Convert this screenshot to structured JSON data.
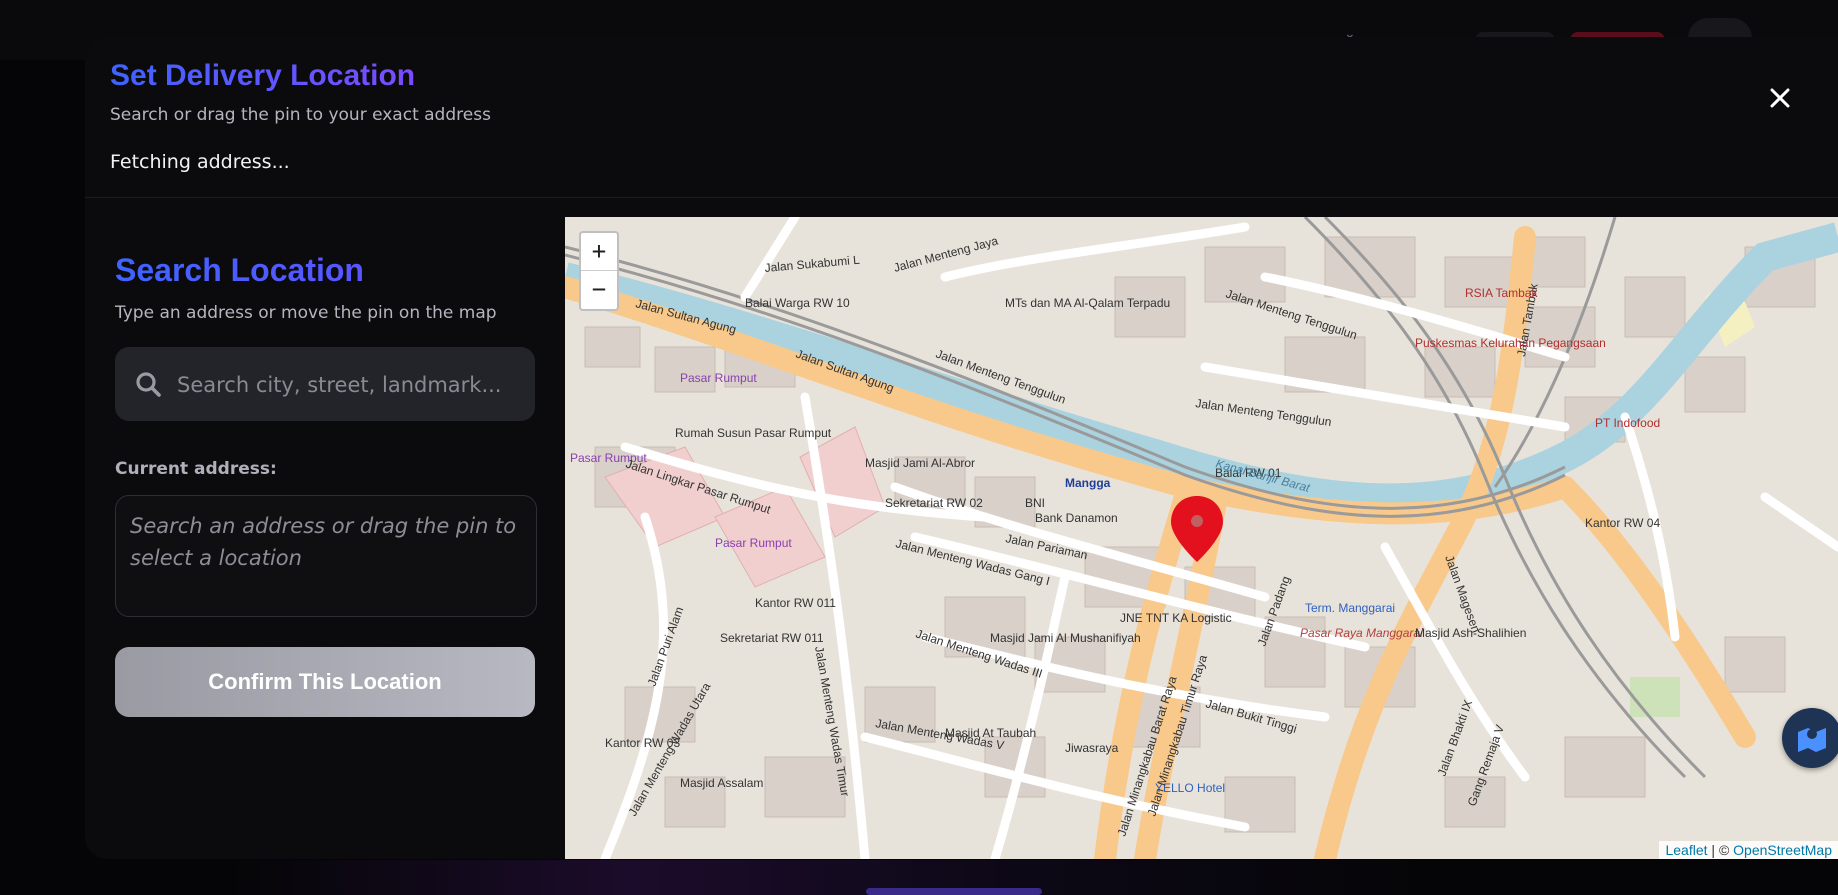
{
  "modal": {
    "title": "Set Delivery Location",
    "subtitle": "Search or drag the pin to your exact address",
    "status": "Fetching address...",
    "close_icon": "close-icon"
  },
  "search": {
    "title": "Search Location",
    "subtitle": "Type an address or move the pin on the map",
    "placeholder": "Search city, street, landmark...",
    "icon": "search-icon"
  },
  "address": {
    "label": "Current address:",
    "placeholder": "Search an address or drag the pin to select a location"
  },
  "confirm_label": "Confirm This Location",
  "map": {
    "zoom_in": "+",
    "zoom_out": "−",
    "attribution_leaflet": "Leaflet",
    "attribution_sep": " | © ",
    "attribution_osm": "OpenStreetMap",
    "layers_icon": "map-layers-icon",
    "labels": {
      "jalan_sultan_agung_1": "Jalan Sultan Agung",
      "jalan_sultan_agung_2": "Jalan Sultan Agung",
      "jalan_sultan_agung_3": "Jalan Sultan Agung",
      "jalan_menteng_tenggulun_1": "Jalan Menteng Tenggulun",
      "jalan_menteng_tenggulun_2": "Jalan Menteng Tenggulun",
      "jalan_menteng_tenggulun_3": "Jalan Menteng Tenggulun",
      "jalan_sukabumi": "Jalan Sukabumi L",
      "jalan_menteng_jaya": "Jalan Menteng Jaya",
      "balai_warga": "Balai Warga RW 10",
      "mts_qalam": "MTs dan MA Al-Qalam Terpadu",
      "pasar_rumput_1": "Pasar Rumput",
      "pasar_rumput_2": "Pasar Rumput",
      "pasar_rumput_3": "Pasar Rumput",
      "rumah_susun": "Rumah Susun Pasar Rumput",
      "jalan_lingkar": "Jalan Lingkar Pasar Rumput",
      "masjid_abror": "Masjid Jami Al-Abror",
      "sekretariat_rw02": "Sekretariat RW 02",
      "bni": "BNI",
      "bank_danamon": "Bank Danamon",
      "jalan_pariaman": "Jalan Pariaman",
      "jalan_wadas_1": "Jalan Menteng Wadas Gang I",
      "jalan_wadas_3": "Jalan Menteng Wadas III",
      "jalan_wadas_5": "Jalan Menteng Wadas V",
      "jalan_wadas_timur": "Jalan Menteng Wadas Timur",
      "jalan_wadas_utara": "Jalan Menteng Wadas Utara",
      "kantor_rw011": "Kantor RW 011",
      "sekretariat_rw011": "Sekretariat RW 011",
      "masjid_mushanif": "Masjid Jami Al Mushanifiyah",
      "masjid_taubah": "Masjid At Taubah",
      "masjid_assalam": "Masjid Assalam",
      "kantor_rw03": "Kantor RW 03",
      "jalan_puri_alam": "Jalan Puri Alam",
      "jne": "JNE TNT KA Logistic",
      "jiwasraya": "Jiwasraya",
      "yello_hotel": "YELLO Hotel",
      "jalan_bukit_tinggi": "Jalan Bukit Tinggi",
      "jalan_padang": "Jalan Padang",
      "jalan_minangkabau_barat": "Jalan Minangkabau Barat Raya",
      "jalan_minangkabau_timur": "Jalan Minangkabau Timur Raya",
      "term_manggarai": "Term. Manggarai",
      "pasar_raya": "Pasar Raya Manggarai",
      "masjid_shalihien": "Masjid Ash-Shalihien",
      "jalan_magesen": "Jalan Magesen",
      "jalan_tambak": "Jalan Tambak",
      "rsia_tambak": "RSIA Tambak",
      "puskesmas": "Puskesmas Kelurahan Pegangsaan",
      "balai_rw01": "Balai RW 01",
      "kantor_rw04": "Kantor RW 04",
      "pt_indofood": "PT Indofood",
      "kanal_banjir": "Kanal Banjir Barat",
      "jalan_bhakti": "Jalan Bhakti IX",
      "gang_remaja": "Gang Remaja V",
      "manggarai": "Mangga"
    }
  },
  "colors": {
    "accent_start": "#3f63ff",
    "accent_end": "#7b4bff",
    "pin": "#e3101e",
    "primary_road": "#f8c98a",
    "water": "#aad3df"
  }
}
